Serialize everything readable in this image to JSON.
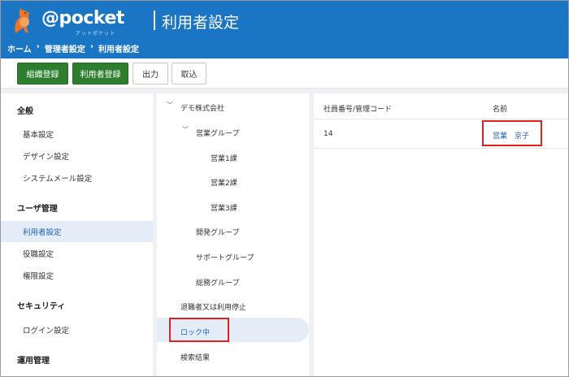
{
  "app": {
    "brand": "@pocket",
    "brand_sub": "アットポケット",
    "page_title": "利用者設定"
  },
  "breadcrumb": [
    "ホーム",
    "›",
    "管理者設定",
    "›",
    "利用者設定"
  ],
  "toolbar": {
    "org_register": "組織登録",
    "user_register": "利用者登録",
    "export": "出力",
    "import": "取込"
  },
  "left_nav": {
    "general_head": "全般",
    "basic": "基本設定",
    "design": "デザイン設定",
    "system_mail": "システムメール設定",
    "user_mgmt_head": "ユーザ管理",
    "user_settings": "利用者設定",
    "role_settings": "役職設定",
    "permission_settings": "権限設定",
    "security_head": "セキュリティ",
    "login_settings": "ログイン設定",
    "operation_head": "運用管理"
  },
  "tree": {
    "company": "デモ株式会社",
    "sales_group": "営業グループ",
    "sales1": "営業1課",
    "sales2": "営業2課",
    "sales3": "営業3課",
    "dev_group": "開発グループ",
    "support_group": "サポートグループ",
    "general_group": "総務グループ",
    "retired": "退職者又は利用停止",
    "locked": "ロック中",
    "search_results": "検索結果"
  },
  "table": {
    "col_id": "社員番号/管理コード",
    "col_name": "名前",
    "rows": [
      {
        "id": "14",
        "name": "営業　京子"
      }
    ]
  },
  "colors": {
    "header": "#1a75c5",
    "green_button": "#2d7f2f",
    "active_bg": "#e4ecf8",
    "link": "#1a63b8",
    "highlight": "#e0201c"
  }
}
